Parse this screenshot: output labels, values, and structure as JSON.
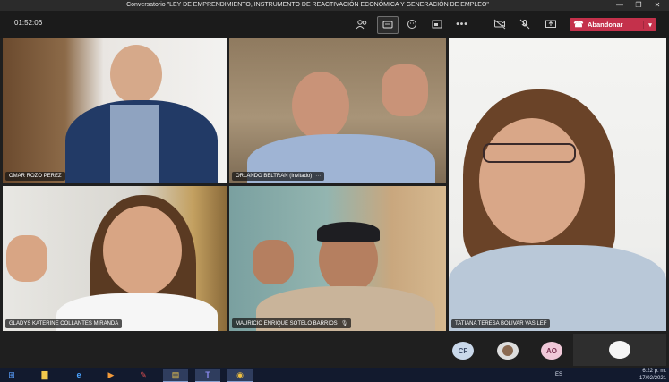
{
  "window": {
    "title": "Conversatorio \"LEY DE EMPRENDIMIENTO, INSTRUMENTO DE REACTIVACIÓN ECONÓMICA Y GENERACIÓN DE EMPLEO\"",
    "minimize": "—",
    "maximize": "❐",
    "close": "✕"
  },
  "meeting": {
    "timer": "01:52:06",
    "leave_label": "Abandonar",
    "leave_icon": "phone-hangup-icon"
  },
  "participants": [
    {
      "name": "OMAR ROZO PEREZ",
      "extra": ""
    },
    {
      "name": "ORLANDO BELTRAN (Invitado)",
      "extra": "···"
    },
    {
      "name": "TATIANA TERESA BOLIVAR VASILEF",
      "extra": ""
    },
    {
      "name": "GLADYS KATERINE COLLANTES MIRANDA",
      "extra": ""
    },
    {
      "name": "MAURICIO ENRIQUE SOTELO BARRIOS",
      "extra": "🎙"
    }
  ],
  "bottom": {
    "avatar1": "CF",
    "avatar3": "AO"
  },
  "taskbar": {
    "start_icon": "windows-icon",
    "tray_text": "ES",
    "time": "6:22 p. m.",
    "date": "17/02/2021"
  },
  "colors": {
    "leave": "#c4314b",
    "toolbar": "#1b1b1b",
    "avatar_cf": "#c9d8ea",
    "avatar_ao": "#f0c8d8"
  }
}
